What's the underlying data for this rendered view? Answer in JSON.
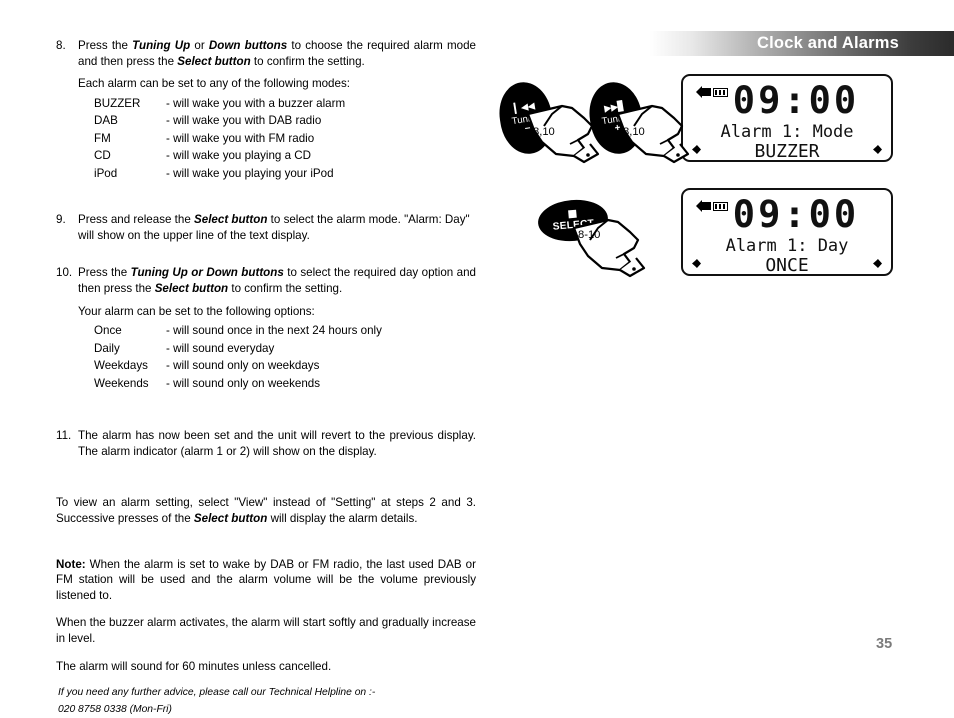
{
  "header": {
    "title": "Clock and Alarms"
  },
  "page": {
    "number": "35"
  },
  "steps": [
    {
      "number": "8.",
      "text_parts": [
        {
          "t": "Press the ",
          "style": "normal"
        },
        {
          "t": "Tuning Up",
          "style": "bold-italic"
        },
        {
          "t": " or ",
          "style": "normal"
        },
        {
          "t": "Down buttons",
          "style": "bold-italic"
        },
        {
          "t": " to choose the required alarm mode and then press the ",
          "style": "normal"
        },
        {
          "t": "Select button",
          "style": "bold-italic"
        },
        {
          "t": " to confirm the setting.",
          "style": "normal"
        }
      ],
      "subline": "Each alarm can be set to any of the following modes:",
      "options": [
        {
          "name": "BUZZER",
          "desc": "- will wake you with a buzzer alarm"
        },
        {
          "name": "DAB",
          "desc": "- will wake you with DAB radio"
        },
        {
          "name": "FM",
          "desc": "- will wake you with FM radio"
        },
        {
          "name": "CD",
          "desc": "- will wake you playing a CD"
        },
        {
          "name": "iPod",
          "desc": "- will wake you playing your iPod"
        }
      ]
    },
    {
      "number": "9.",
      "text_parts": [
        {
          "t": "Press and release the ",
          "style": "normal"
        },
        {
          "t": "Select button",
          "style": "bold-italic"
        },
        {
          "t": " to select the alarm mode. \"Alarm: Day\" will show on the upper line of the text display.",
          "style": "normal"
        }
      ]
    },
    {
      "number": "10.",
      "text_parts": [
        {
          "t": "Press the ",
          "style": "normal"
        },
        {
          "t": "Tuning Up or Down buttons",
          "style": "bold-italic"
        },
        {
          "t": " to select the required day option and then press the ",
          "style": "normal"
        },
        {
          "t": "Select button",
          "style": "bold-italic"
        },
        {
          "t": " to confirm the setting.",
          "style": "normal"
        }
      ],
      "subline": "Your alarm can be set to the following options:",
      "options": [
        {
          "name": "Once",
          "desc": "- will sound once in the next 24 hours only"
        },
        {
          "name": "Daily",
          "desc": "- will sound everyday"
        },
        {
          "name": "Weekdays",
          "desc": "- will sound only on weekdays"
        },
        {
          "name": "Weekends",
          "desc": "- will sound only on weekends"
        }
      ]
    },
    {
      "number": "11.",
      "text_parts": [
        {
          "t": "The alarm has now been set and the unit will revert to the previous display. The alarm indicator (alarm 1 or 2) will show on the display.",
          "style": "normal"
        }
      ]
    }
  ],
  "view_paragraph": [
    {
      "t": "To view an alarm setting, select \"View\" instead of \"Setting\" at steps 2 and 3. Successive presses of the ",
      "style": "normal"
    },
    {
      "t": "Select button",
      "style": "bold-italic"
    },
    {
      "t": " will display the alarm details.",
      "style": "normal"
    }
  ],
  "notes": [
    [
      {
        "t": "Note:",
        "style": "bold"
      },
      {
        "t": " When the alarm is set to wake by DAB or FM radio, the last used DAB or FM station will be used and the alarm volume will be the volume previously listened to.",
        "style": "normal"
      }
    ],
    [
      {
        "t": "When the buzzer alarm activates, the alarm will start softly and gradually increase in level.",
        "style": "normal"
      }
    ],
    [
      {
        "t": "The alarm will sound for 60 minutes unless cancelled.",
        "style": "normal"
      }
    ]
  ],
  "helpline": {
    "line1": "If you need any further advice, please call our Technical Helpline on :-",
    "line2": "020 8758 0338 (Mon-Fri)"
  },
  "buttons": [
    {
      "id": "tuning-down",
      "icon": "skip-back-icon",
      "icon_glyph": "▎◀◀",
      "label": "Tuning",
      "sign": "–",
      "hand_label": "8,10"
    },
    {
      "id": "tuning-up",
      "icon": "skip-forward-icon",
      "icon_glyph": "▶▶▊",
      "label": "Tuning",
      "sign": "+",
      "hand_label": "8,10"
    },
    {
      "id": "select",
      "icon": "stop-square-icon",
      "label": "SELECT",
      "hand_label": "8-10"
    }
  ],
  "displays": [
    {
      "id": "display-alarm-mode",
      "volume_icon": "speaker-volume-icon",
      "time": "09:00",
      "line1": "Alarm 1: Mode",
      "line2": "BUZZER"
    },
    {
      "id": "display-alarm-day",
      "volume_icon": "speaker-volume-icon",
      "time": "09:00",
      "line1": "Alarm 1: Day",
      "line2": "ONCE"
    }
  ],
  "colors": {
    "text": "#000000",
    "header_text": "#ffffff",
    "header_dark": "#2b2b2b",
    "page_number": "#7b7b7b"
  }
}
